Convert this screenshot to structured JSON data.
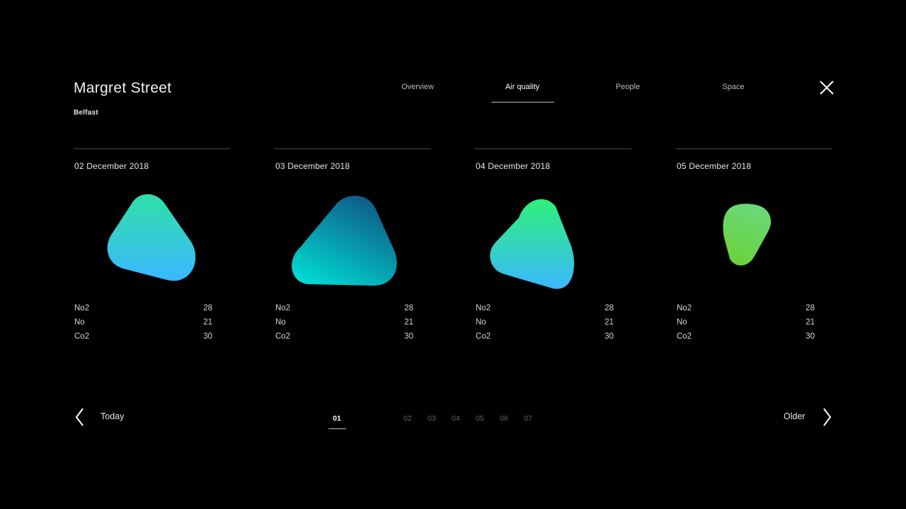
{
  "header": {
    "title": "Margret Street",
    "subtitle": "Belfast"
  },
  "tabs": [
    {
      "label": "Overview",
      "active": false
    },
    {
      "label": "Air quality",
      "active": true
    },
    {
      "label": "People",
      "active": false
    },
    {
      "label": "Space",
      "active": false
    }
  ],
  "close_icon": "close-icon",
  "cards": [
    {
      "date": "02 December 2018",
      "metrics": [
        {
          "label": "No2",
          "value": "28"
        },
        {
          "label": "No",
          "value": "21"
        },
        {
          "label": "Co2",
          "value": "30"
        }
      ],
      "gradient": [
        "#2fe0a8",
        "#3ab8ff"
      ]
    },
    {
      "date": "03 December 2018",
      "metrics": [
        {
          "label": "No2",
          "value": "28"
        },
        {
          "label": "No",
          "value": "21"
        },
        {
          "label": "Co2",
          "value": "30"
        }
      ],
      "gradient": [
        "#0e5a86",
        "#00e0d6"
      ]
    },
    {
      "date": "04 December 2018",
      "metrics": [
        {
          "label": "No2",
          "value": "28"
        },
        {
          "label": "No",
          "value": "21"
        },
        {
          "label": "Co2",
          "value": "30"
        }
      ],
      "gradient": [
        "#2ef07a",
        "#3ab8ff"
      ]
    },
    {
      "date": "05 December 2018",
      "metrics": [
        {
          "label": "No2",
          "value": "28"
        },
        {
          "label": "No",
          "value": "21"
        },
        {
          "label": "Co2",
          "value": "30"
        }
      ],
      "gradient": [
        "#6bd87a",
        "#6ad23a"
      ]
    }
  ],
  "pager": {
    "prev_label": "Today",
    "next_label": "Older",
    "pages": [
      "01",
      "02",
      "03",
      "04",
      "05",
      "06",
      "07"
    ],
    "current": "01"
  }
}
